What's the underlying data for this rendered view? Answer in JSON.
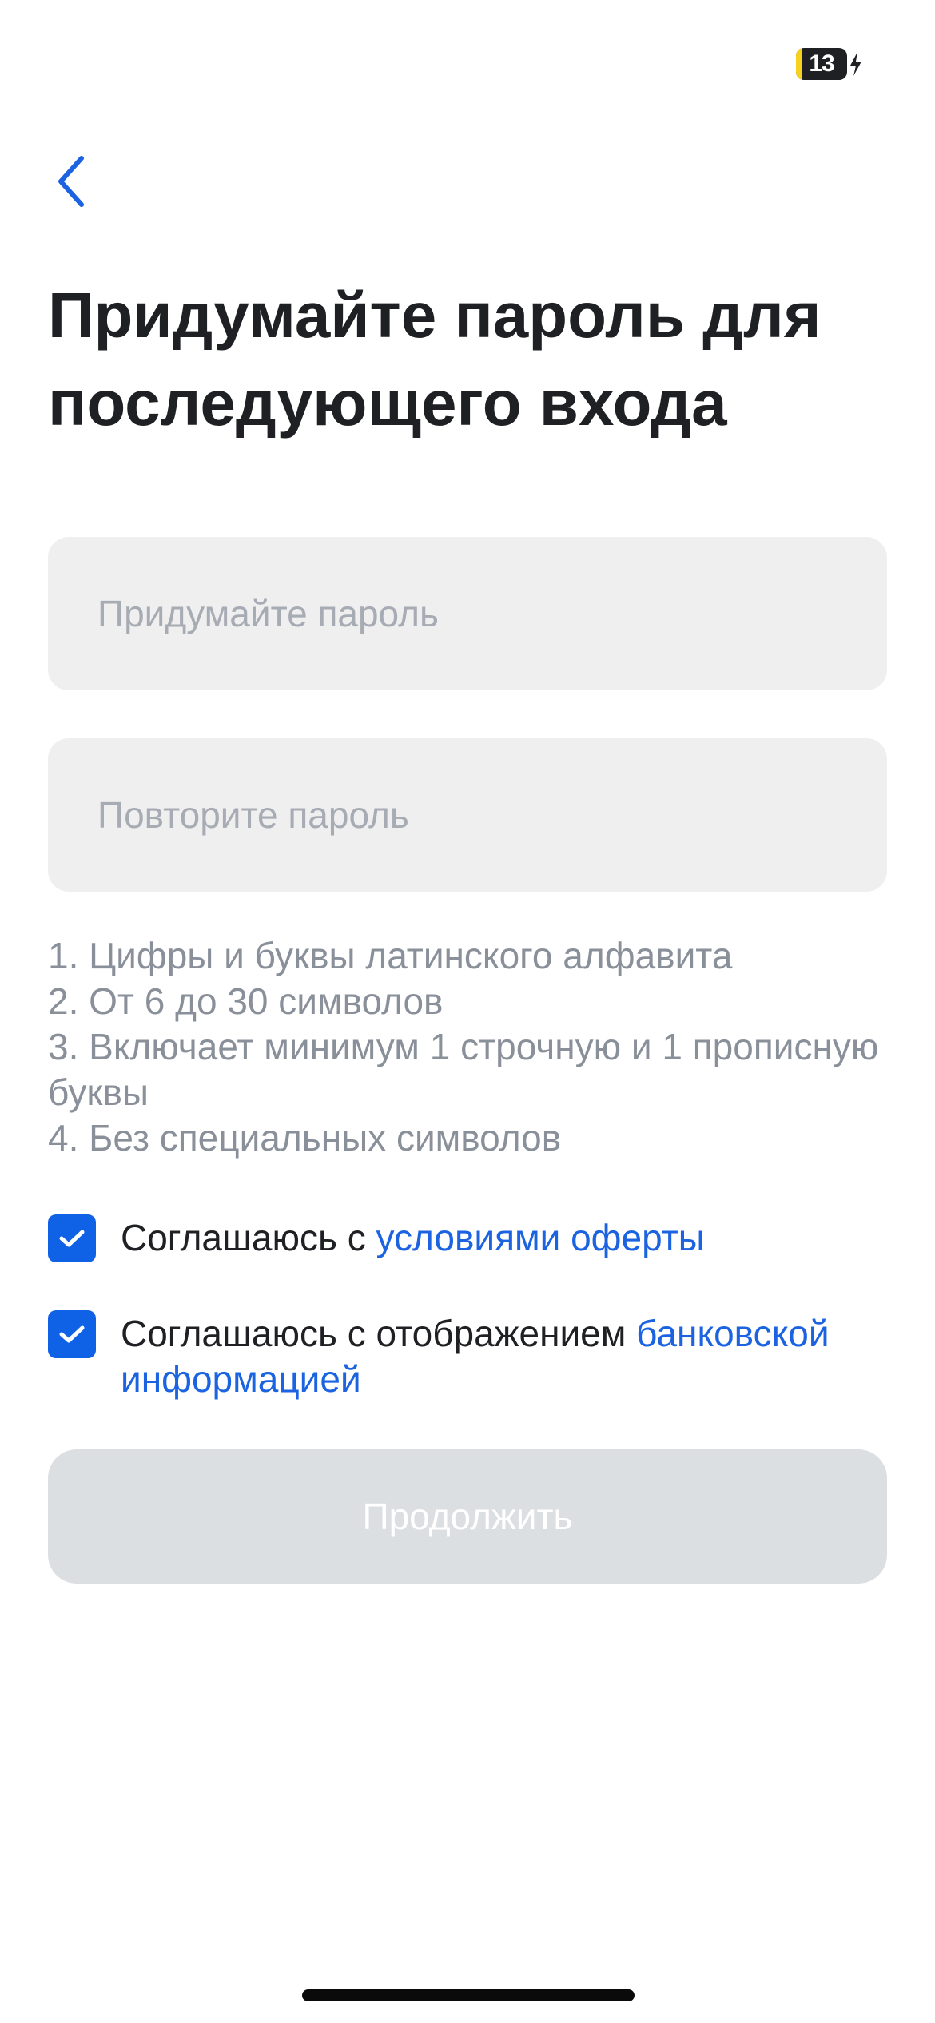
{
  "status_bar": {
    "battery_level": "13",
    "battery_color": "#f7d21d"
  },
  "header": {
    "back_icon": "chevron-left-icon",
    "title": "Придумайте пароль для последующего входа"
  },
  "form": {
    "password_placeholder": "Придумайте пароль",
    "password_value": "",
    "repeat_placeholder": "Повторите пароль",
    "repeat_value": ""
  },
  "requirements": [
    "1. Цифры и буквы латинского алфавита",
    "2. От 6 до 30 символов",
    "3. Включает минимум 1 строчную и 1 прописную буквы",
    "4. Без специальных символов"
  ],
  "agreements": [
    {
      "checked": true,
      "text": "Соглашаюсь с ",
      "link": "условиями оферты"
    },
    {
      "checked": true,
      "text": "Соглашаюсь с отображением ",
      "link": "банковской информацией"
    }
  ],
  "continue_button": {
    "label": "Продолжить",
    "disabled": true
  },
  "colors": {
    "accent": "#0f61e6",
    "link": "#1b63e0",
    "disabled_button": "#dcdfe2",
    "hint_text": "#8a909a"
  }
}
